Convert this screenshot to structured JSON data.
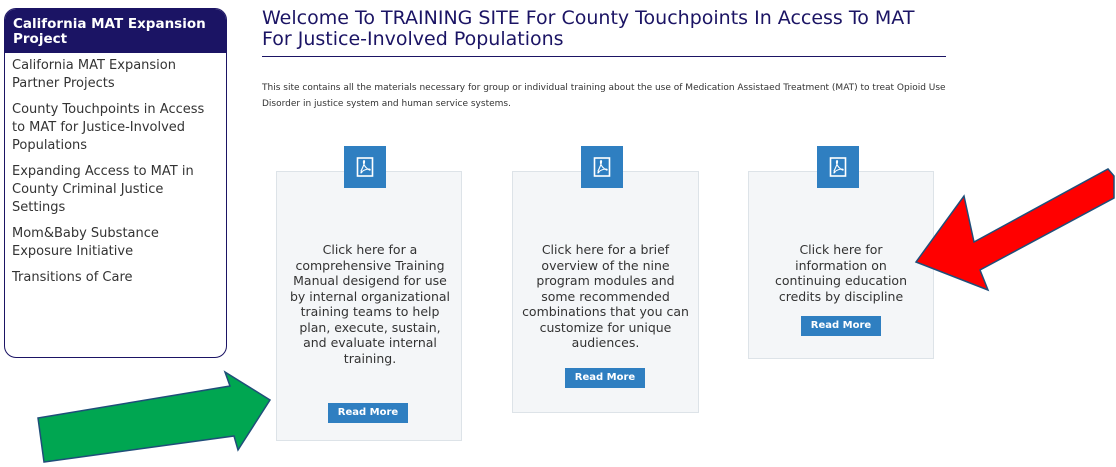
{
  "sidebar": {
    "header": "California MAT Expansion Project",
    "items": [
      {
        "label": "California MAT Expansion Partner Projects"
      },
      {
        "label": "County Touchpoints in Access to MAT for Justice-Involved Populations"
      },
      {
        "label": "Expanding Access to MAT in County Criminal Justice Settings"
      },
      {
        "label": "Mom&Baby Substance Exposure Initiative"
      },
      {
        "label": "Transitions of Care"
      }
    ]
  },
  "main": {
    "title": "Welcome To TRAINING SITE For County Touchpoints In Access To MAT For Justice-Involved Populations",
    "intro": "This site contains all the materials necessary for group or individual training about the use of Medication Assistaed Treatment (MAT) to treat Opioid Use Disorder in justice system and human service systems.",
    "cards": [
      {
        "text": "Click here for a comprehensive Training Manual desigend for use by internal organizational training teams to help plan, execute, sustain, and evaluate internal training.",
        "button": "Read More",
        "icon": "pdf-icon"
      },
      {
        "text": "Click here for a brief overview of the nine program modules and some recommended combinations that you can customize for unique audiences.",
        "button": "Read More",
        "icon": "pdf-icon"
      },
      {
        "text": "Click here for information on continuing education credits by discipline",
        "button": "Read More",
        "icon": "pdf-icon"
      }
    ]
  },
  "annotations": {
    "green_arrow_color": "#00a651",
    "red_arrow_color": "#ff0000",
    "icons": [
      "green-arrow",
      "red-arrow"
    ]
  },
  "colors": {
    "brand": "#1b1464",
    "accent": "#2f7fc1"
  }
}
